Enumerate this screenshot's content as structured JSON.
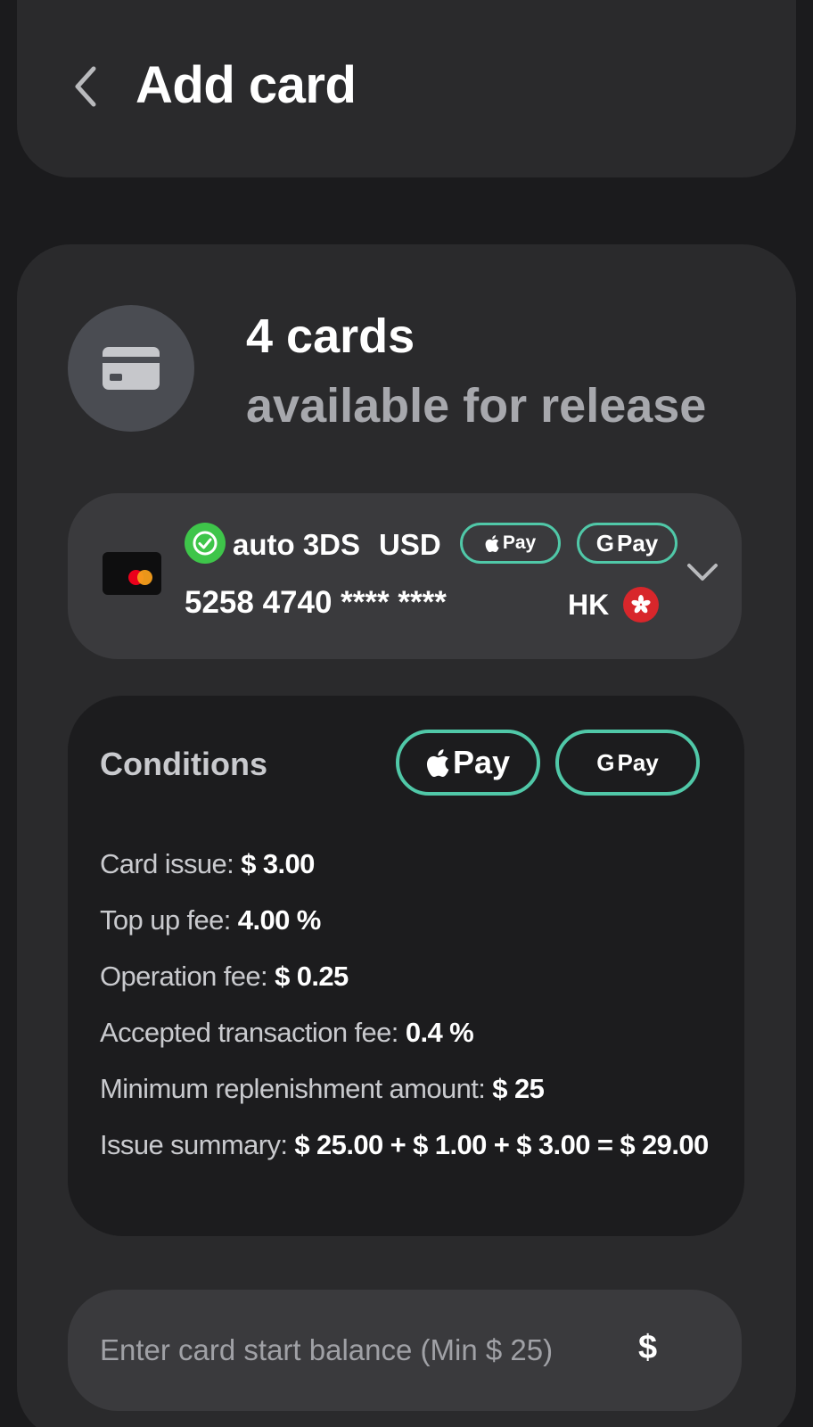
{
  "header": {
    "title": "Add card"
  },
  "summary": {
    "count": "4 cards",
    "subtitle": "available for release"
  },
  "card_selector": {
    "feature": "auto 3DS",
    "currency": "USD",
    "apple_pay_label": "Pay",
    "google_pay_label": "Pay",
    "number": "5258 4740 **** ****",
    "country": "HK"
  },
  "conditions": {
    "title": "Conditions",
    "apple_pay_label": "Pay",
    "google_pay_label": "Pay",
    "items": [
      {
        "label": "Card issue:",
        "value": " $ 3.00"
      },
      {
        "label": "Top up fee:",
        "value": " 4.00 %"
      },
      {
        "label": "Operation fee:",
        "value": " $ 0.25"
      },
      {
        "label": "Accepted transaction fee:",
        "value": "  0.4 %"
      },
      {
        "label": "Minimum replenishment amount:",
        "value": " $ 25"
      },
      {
        "label": "Issue summary:",
        "value": " $ 25.00 + $ 1.00 + $ 3.00 = $ 29.00"
      }
    ]
  },
  "balance": {
    "placeholder": "Enter card start balance (Min $ 25)",
    "currency_symbol": "$"
  },
  "colors": {
    "background": "#1b1b1d",
    "panel": "#2a2a2c",
    "accent_pill_border": "#50c8a8",
    "success": "#3ec54a",
    "flag_red": "#d8262b"
  }
}
